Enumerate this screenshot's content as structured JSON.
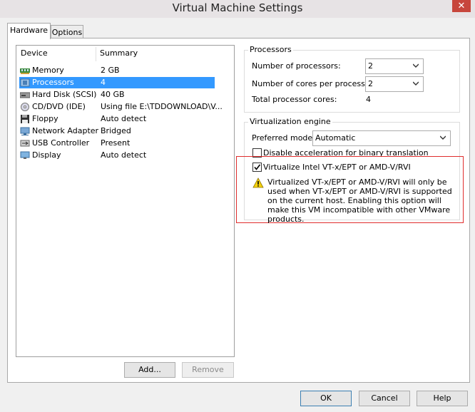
{
  "window": {
    "title": "Virtual Machine Settings",
    "close_glyph": "✕"
  },
  "tabs": [
    {
      "label": "Hardware"
    },
    {
      "label": "Options"
    }
  ],
  "device_list": {
    "headers": {
      "device": "Device",
      "summary": "Summary"
    },
    "rows": [
      {
        "device": "Memory",
        "summary": "2 GB",
        "icon": "memory-icon"
      },
      {
        "device": "Processors",
        "summary": "4",
        "icon": "processor-icon",
        "selected": true
      },
      {
        "device": "Hard Disk (SCSI)",
        "summary": "40 GB",
        "icon": "hard-disk-icon"
      },
      {
        "device": "CD/DVD (IDE)",
        "summary": "Using file E:\\TDDOWNLOAD\\V...",
        "icon": "cd-dvd-icon"
      },
      {
        "device": "Floppy",
        "summary": "Auto detect",
        "icon": "floppy-icon"
      },
      {
        "device": "Network Adapter",
        "summary": "Bridged",
        "icon": "network-adapter-icon"
      },
      {
        "device": "USB Controller",
        "summary": "Present",
        "icon": "usb-icon"
      },
      {
        "device": "Display",
        "summary": "Auto detect",
        "icon": "display-icon"
      }
    ]
  },
  "buttons": {
    "add": "Add...",
    "remove": "Remove",
    "ok": "OK",
    "cancel": "Cancel",
    "help": "Help"
  },
  "processors": {
    "group_label": "Processors",
    "num_processors_label": "Number of processors:",
    "num_processors_value": "2",
    "cores_label": "Number of cores per processor:",
    "cores_value": "2",
    "total_label": "Total processor cores:",
    "total_value": "4"
  },
  "virtualization": {
    "group_label": "Virtualization engine",
    "mode_label": "Preferred mode:",
    "mode_value": "Automatic",
    "disable_accel_label": "Disable acceleration for binary translation",
    "disable_accel_checked": false,
    "vtx_label": "Virtualize Intel VT-x/EPT or AMD-V/RVI",
    "vtx_checked": true,
    "warning_text": "Virtualized VT-x/EPT or AMD-V/RVI will only be used when VT-x/EPT or AMD-V/RVI is supported on the current host. Enabling this option will make this VM incompatible with other VMware products.",
    "warning_icon": "warning-icon"
  },
  "colors": {
    "selection": "#3399ff",
    "highlight_border": "#e02d2d",
    "close_button": "#c7463c"
  }
}
